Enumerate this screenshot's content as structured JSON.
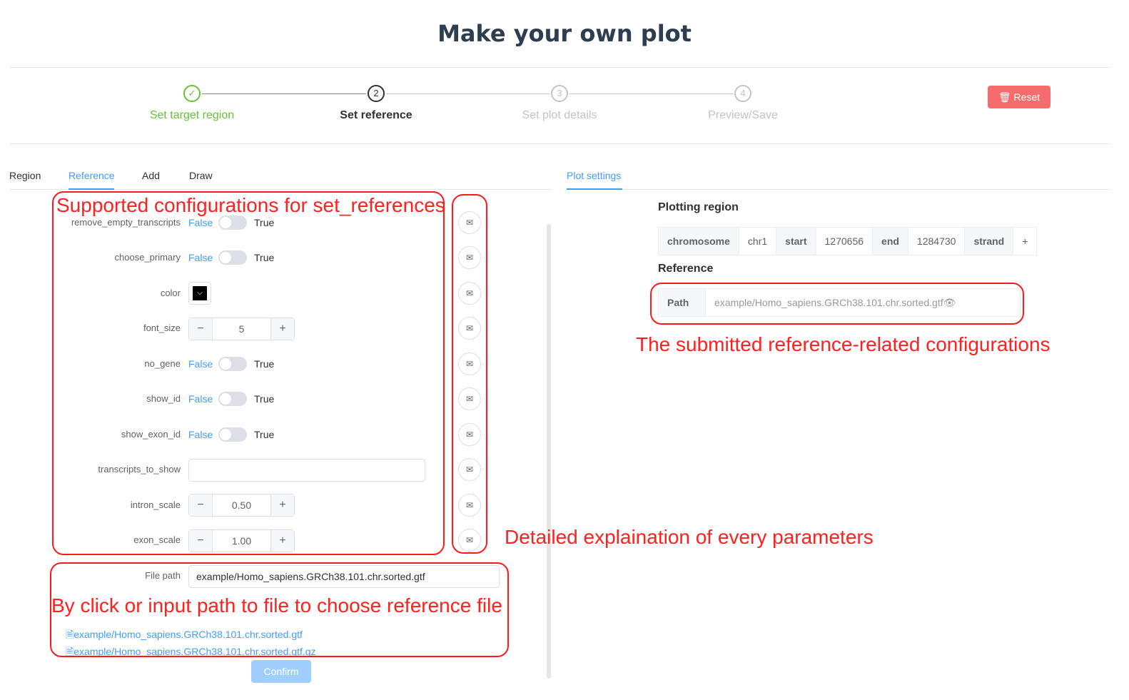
{
  "page_title": "Make your own plot",
  "steps": [
    {
      "number": "1",
      "label": "Set target region",
      "state": "done"
    },
    {
      "number": "2",
      "label": "Set reference",
      "state": "active"
    },
    {
      "number": "3",
      "label": "Set plot details",
      "state": "pending"
    },
    {
      "number": "4",
      "label": "Preview/Save",
      "state": "pending"
    }
  ],
  "reset_label": "Reset",
  "left_tabs": [
    "Region",
    "Reference",
    "Add",
    "Draw"
  ],
  "right_tabs": [
    "Plot settings"
  ],
  "form": {
    "false_label": "False",
    "true_label": "True",
    "labels": {
      "remove_empty_transcripts": "remove_empty_transcripts",
      "choose_primary": "choose_primary",
      "color": "color",
      "font_size": "font_size",
      "no_gene": "no_gene",
      "show_id": "show_id",
      "show_exon_id": "show_exon_id",
      "transcripts_to_show": "transcripts_to_show",
      "intron_scale": "intron_scale",
      "exon_scale": "exon_scale",
      "file_path": "File path"
    },
    "values": {
      "font_size": "5",
      "intron_scale": "0.50",
      "exon_scale": "1.00",
      "transcripts_to_show": "",
      "file_path": "example/Homo_sapiens.GRCh38.101.chr.sorted.gtf"
    },
    "color_value": "#000000"
  },
  "file_options": [
    "example/Homo_sapiens.GRCh38.101.chr.sorted.gtf",
    "example/Homo_sapiens.GRCh38.101.chr.sorted.gtf.gz"
  ],
  "confirm_label": "Confirm",
  "plot_settings": {
    "region_heading": "Plotting region",
    "region": {
      "chromosome_key": "chromosome",
      "chromosome": "chr1",
      "start_key": "start",
      "start": "1270656",
      "end_key": "end",
      "end": "1284730",
      "strand_key": "strand",
      "strand": "+"
    },
    "reference_heading": "Reference",
    "path_key": "Path",
    "path_value": "example/Homo_sapiens.GRCh38.101.chr.sorted.gtf"
  },
  "annotations": {
    "configs": "Supported configurations for set_references",
    "submitted": "The submitted reference-related configurations",
    "explain": "Detailed explaination of every parameters",
    "choose_file": "By click or input path to file to choose reference file"
  },
  "colors": {
    "accent": "#409eff",
    "success": "#67c23a",
    "danger": "#f56c6c",
    "annotation": "#ff1a1a"
  }
}
